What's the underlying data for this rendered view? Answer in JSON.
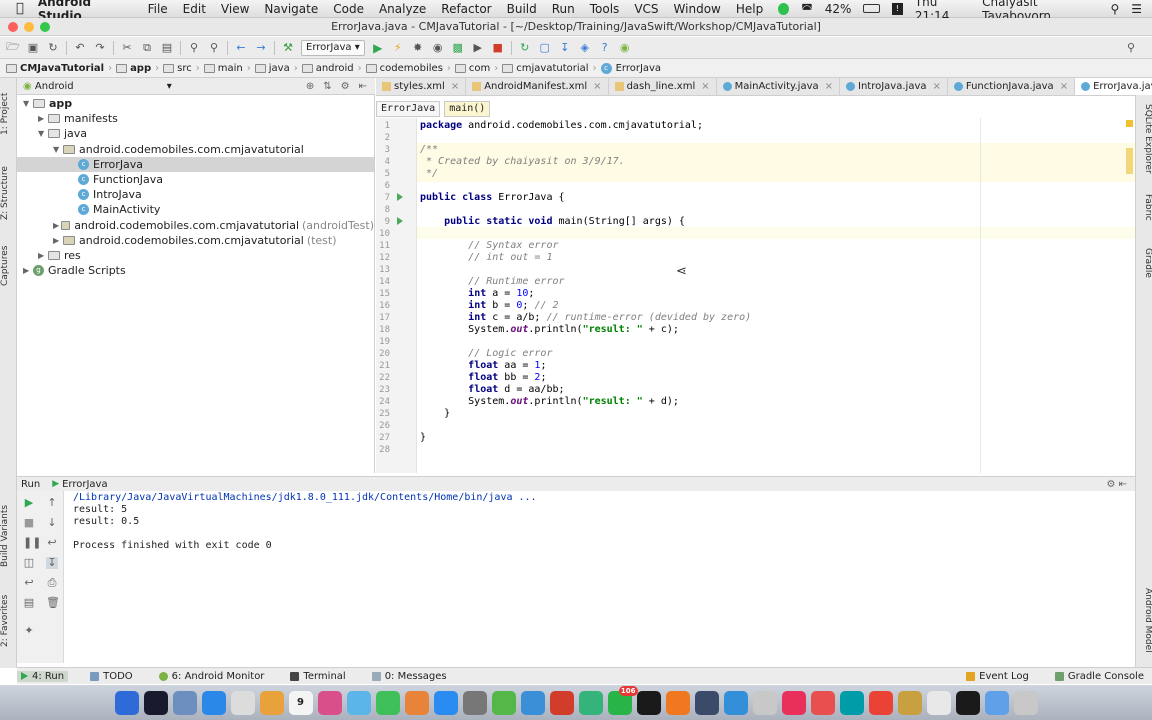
{
  "menubar": {
    "app": "Android Studio",
    "items": [
      "File",
      "Edit",
      "View",
      "Navigate",
      "Code",
      "Analyze",
      "Refactor",
      "Build",
      "Run",
      "Tools",
      "VCS",
      "Window",
      "Help"
    ],
    "battery": "42%",
    "clock": "Thu 21:14",
    "user": "Chaiyasit Tayabovorn"
  },
  "window": {
    "title": "ErrorJava.java - CMJavaTutorial - [~/Desktop/Training/JavaSwift/Workshop/CMJavaTutorial]"
  },
  "toolbar": {
    "run_config": "ErrorJava"
  },
  "breadcrumbs": [
    "CMJavaTutorial",
    "app",
    "src",
    "main",
    "java",
    "android",
    "codemobiles",
    "com",
    "cmjavatutorial",
    "ErrorJava"
  ],
  "project": {
    "view": "Android",
    "tree": [
      {
        "label": "app",
        "level": 0,
        "open": true,
        "kind": "folder",
        "bold": true
      },
      {
        "label": "manifests",
        "level": 1,
        "open": false,
        "kind": "folder"
      },
      {
        "label": "java",
        "level": 1,
        "open": true,
        "kind": "folder"
      },
      {
        "label": "android.codemobiles.com.cmjavatutorial",
        "level": 2,
        "open": true,
        "kind": "package"
      },
      {
        "label": "ErrorJava",
        "level": 3,
        "kind": "class",
        "selected": true
      },
      {
        "label": "FunctionJava",
        "level": 3,
        "kind": "class"
      },
      {
        "label": "IntroJava",
        "level": 3,
        "kind": "class"
      },
      {
        "label": "MainActivity",
        "level": 3,
        "kind": "class"
      },
      {
        "label": "android.codemobiles.com.cmjavatutorial",
        "suffix": "(androidTest)",
        "level": 2,
        "open": false,
        "kind": "package"
      },
      {
        "label": "android.codemobiles.com.cmjavatutorial",
        "suffix": "(test)",
        "level": 2,
        "open": false,
        "kind": "package"
      },
      {
        "label": "res",
        "level": 1,
        "open": false,
        "kind": "folder"
      },
      {
        "label": "Gradle Scripts",
        "level": 0,
        "open": false,
        "kind": "gradle"
      }
    ]
  },
  "tabs": [
    {
      "label": "styles.xml",
      "type": "xml",
      "active": false
    },
    {
      "label": "AndroidManifest.xml",
      "type": "xml",
      "active": false
    },
    {
      "label": "dash_line.xml",
      "type": "xml",
      "active": false
    },
    {
      "label": "MainActivity.java",
      "type": "java",
      "active": false
    },
    {
      "label": "IntroJava.java",
      "type": "java",
      "active": false
    },
    {
      "label": "FunctionJava.java",
      "type": "java",
      "active": false
    },
    {
      "label": "ErrorJava.java",
      "type": "java",
      "active": true
    }
  ],
  "tabs_overflow": "⋮1",
  "editor_breadcrumb": {
    "class": "ErrorJava",
    "method": "main()"
  },
  "code": [
    [
      [
        "k",
        "package "
      ],
      [
        "t",
        "android.codemobiles.com.cmjavatutorial;"
      ]
    ],
    [],
    [
      [
        "c",
        "/**"
      ]
    ],
    [
      [
        "c",
        " * Created by chaiyasit on 3/9/17."
      ]
    ],
    [
      [
        "c",
        " */"
      ]
    ],
    [],
    [
      [
        "k",
        "public class "
      ],
      [
        "t",
        "ErrorJava {"
      ]
    ],
    [],
    [
      [
        "t",
        "    "
      ],
      [
        "k",
        "public static void "
      ],
      [
        "t",
        "main(String[] args) {"
      ]
    ],
    [],
    [
      [
        "t",
        "        "
      ],
      [
        "c",
        "// Syntax error"
      ]
    ],
    [
      [
        "t",
        "        "
      ],
      [
        "c",
        "// int out = 1"
      ]
    ],
    [],
    [
      [
        "t",
        "        "
      ],
      [
        "c",
        "// Runtime error"
      ]
    ],
    [
      [
        "t",
        "        "
      ],
      [
        "k",
        "int "
      ],
      [
        "t",
        "a = "
      ],
      [
        "n",
        "10"
      ],
      [
        "t",
        ";"
      ]
    ],
    [
      [
        "t",
        "        "
      ],
      [
        "k",
        "int "
      ],
      [
        "t",
        "b = "
      ],
      [
        "n",
        "0"
      ],
      [
        "t",
        "; "
      ],
      [
        "c",
        "// 2"
      ]
    ],
    [
      [
        "t",
        "        "
      ],
      [
        "k",
        "int "
      ],
      [
        "t",
        "c = a/b; "
      ],
      [
        "c",
        "// runtime-error (devided by zero)"
      ]
    ],
    [
      [
        "t",
        "        System."
      ],
      [
        "f",
        "out"
      ],
      [
        "t",
        ".println("
      ],
      [
        "s",
        "\"result: \""
      ],
      [
        "t",
        " + c);"
      ]
    ],
    [],
    [
      [
        "t",
        "        "
      ],
      [
        "c",
        "// Logic error"
      ]
    ],
    [
      [
        "t",
        "        "
      ],
      [
        "k",
        "float "
      ],
      [
        "t",
        "aa = "
      ],
      [
        "n",
        "1"
      ],
      [
        "t",
        ";"
      ]
    ],
    [
      [
        "t",
        "        "
      ],
      [
        "k",
        "float "
      ],
      [
        "t",
        "bb = "
      ],
      [
        "n",
        "2"
      ],
      [
        "t",
        ";"
      ]
    ],
    [
      [
        "t",
        "        "
      ],
      [
        "k",
        "float "
      ],
      [
        "t",
        "d = aa/bb;"
      ]
    ],
    [
      [
        "t",
        "        System."
      ],
      [
        "f",
        "out"
      ],
      [
        "t",
        ".println("
      ],
      [
        "s",
        "\"result: \""
      ],
      [
        "t",
        " + d);"
      ]
    ],
    [
      [
        "t",
        "    }"
      ]
    ],
    [],
    [
      [
        "t",
        "}"
      ]
    ],
    []
  ],
  "run_panel": {
    "title": "Run",
    "config": "ErrorJava",
    "output": [
      "/Library/Java/JavaVirtualMachines/jdk1.8.0_111.jdk/Contents/Home/bin/java ...",
      "result: 5",
      "result: 0.5",
      "",
      "Process finished with exit code 0"
    ]
  },
  "left_strip": {
    "project": "1: Project",
    "structure": "Z: Structure",
    "captures": "Captures",
    "build_variants": "Build Variants",
    "favorites": "2: Favorites"
  },
  "right_strip": {
    "sqlite": "SQLite Explorer",
    "fabric": "Fabric",
    "gradle": "Gradle",
    "android_model": "Android Model"
  },
  "statusbar": {
    "left": [
      {
        "label": "4: Run",
        "active": true
      },
      {
        "label": "TODO"
      },
      {
        "label": "6: Android Monitor"
      },
      {
        "label": "Terminal"
      },
      {
        "label": "0: Messages"
      }
    ],
    "right": [
      {
        "label": "Event Log"
      },
      {
        "label": "Gradle Console"
      }
    ]
  },
  "dock": {
    "calendar_day": "9",
    "badge": "106",
    "apps": [
      "#2f6bd8",
      "#1a1a2e",
      "#6c8fbf",
      "#2a88e8",
      "#dcdcdc",
      "#e9a23b",
      "#f4f4f4",
      "#d84f8a",
      "#5bb5e8",
      "#3fbf5a",
      "#e8843a",
      "#2a8bf0",
      "#777",
      "#54b848",
      "#3a8fd6",
      "#d23c2a",
      "#34b47a",
      "#28b446",
      "#1a1a1a",
      "#f07820",
      "#3c4a6a",
      "#3390d8",
      "#c8c8c8",
      "#e8305a",
      "#e85050",
      "#009ca8",
      "#ea4335",
      "#c8a040",
      "#e8e8e8",
      "#1a1a1a",
      "#5fa0e8",
      "#c8c8c8"
    ]
  }
}
